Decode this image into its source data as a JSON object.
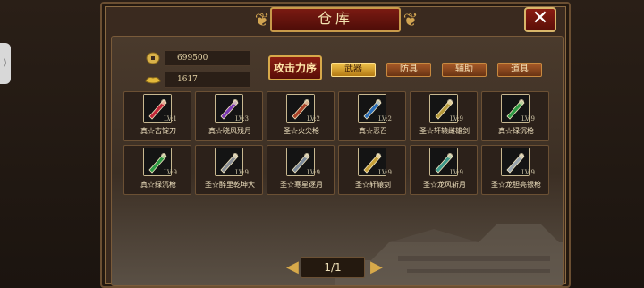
{
  "side_tab": {
    "glyph": "⟩"
  },
  "title": "仓库",
  "close_glyph": "✕",
  "currency": [
    {
      "icon": "copper-coin-icon",
      "value": "699500"
    },
    {
      "icon": "gold-ingot-icon",
      "value": "1617"
    }
  ],
  "sort_label": "攻击力序",
  "tabs": [
    {
      "label": "武器",
      "active": true
    },
    {
      "label": "防具",
      "active": false
    },
    {
      "label": "辅助",
      "active": false
    },
    {
      "label": "道具",
      "active": false
    }
  ],
  "items": [
    {
      "name": "真☆古锭刀",
      "level": "LV:1",
      "icon": "red-blade-icon",
      "color": "#c2283a"
    },
    {
      "name": "真☆晓风残月",
      "level": "LV:3",
      "icon": "purple-fan-icon",
      "color": "#7c3bb2"
    },
    {
      "name": "圣☆火尖枪",
      "level": "LV:2",
      "icon": "fire-spear-icon",
      "color": "#a84228"
    },
    {
      "name": "真☆恶召",
      "level": "LV:2",
      "icon": "blue-blade-icon",
      "color": "#2c6fb8"
    },
    {
      "name": "圣☆轩辕雌雄剑",
      "level": "LV:9",
      "icon": "twin-sword-icon",
      "color": "#b59a3c"
    },
    {
      "name": "真☆绿沉枪",
      "level": "LV:9",
      "icon": "green-spear-icon",
      "color": "#2e9a46"
    },
    {
      "name": "真☆绿沉枪",
      "level": "LV:9",
      "icon": "green-spear-icon",
      "color": "#2e9a46"
    },
    {
      "name": "圣☆醉里乾坤大",
      "level": "LV:9",
      "icon": "axe-icon",
      "color": "#8a8f96"
    },
    {
      "name": "圣☆寒星逐月",
      "level": "LV:9",
      "icon": "silver-spear-icon",
      "color": "#7c8a9a"
    },
    {
      "name": "圣☆轩辕剑",
      "level": "LV:9",
      "icon": "gold-sword-icon",
      "color": "#c7a038"
    },
    {
      "name": "圣☆龙风斩月",
      "level": "LV:9",
      "icon": "dragon-blade-icon",
      "color": "#3f9a8c"
    },
    {
      "name": "圣☆龙胆亮银枪",
      "level": "LV:9",
      "icon": "silver-lance-icon",
      "color": "#9aa6b0"
    }
  ],
  "page": "1/1"
}
